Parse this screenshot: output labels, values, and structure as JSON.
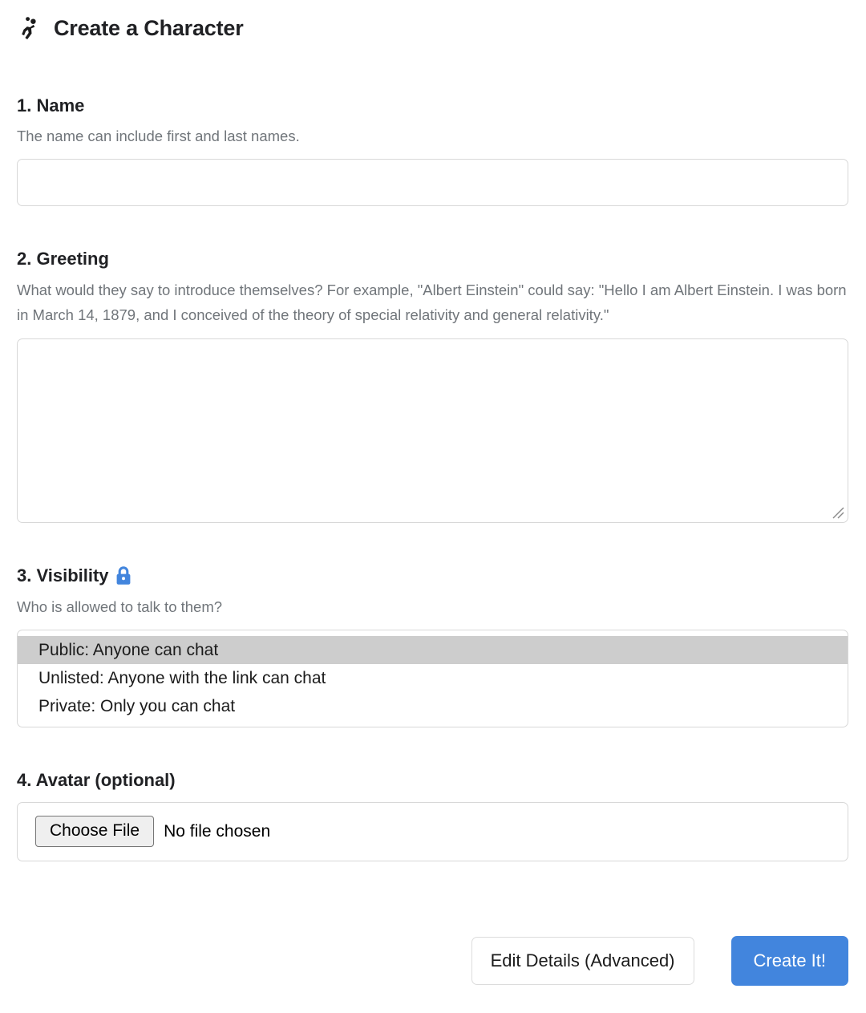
{
  "header": {
    "icon": "handball-player-icon",
    "title": "Create a Character"
  },
  "sections": [
    {
      "heading": "1. Name",
      "description": "The name can include first and last names.",
      "input": {
        "value": "",
        "placeholder": ""
      }
    },
    {
      "heading": "2. Greeting",
      "description": "What would they say to introduce themselves? For example, \"Albert Einstein\" could say: \"Hello I am Albert Einstein. I was born in March 14, 1879, and I conceived of the theory of special relativity and general relativity.\"",
      "textarea": {
        "value": "",
        "placeholder": ""
      }
    },
    {
      "heading": "3. Visibility",
      "heading_icon": "lock-icon",
      "description": "Who is allowed to talk to them?",
      "options": [
        {
          "label": "Public: Anyone can chat",
          "selected": true
        },
        {
          "label": "Unlisted: Anyone with the link can chat",
          "selected": false
        },
        {
          "label": "Private: Only you can chat",
          "selected": false
        }
      ]
    },
    {
      "heading": "4. Avatar (optional)",
      "file_input": {
        "button_label": "Choose File",
        "status": "No file chosen"
      }
    }
  ],
  "actions": {
    "secondary_label": "Edit Details (Advanced)",
    "primary_label": "Create It!"
  },
  "colors": {
    "accent": "#4285dd",
    "lock": "#4285dd",
    "heading": "#202124",
    "description": "#70757a",
    "border": "#d8d8d8",
    "selected_option": "#cdcdcd"
  }
}
